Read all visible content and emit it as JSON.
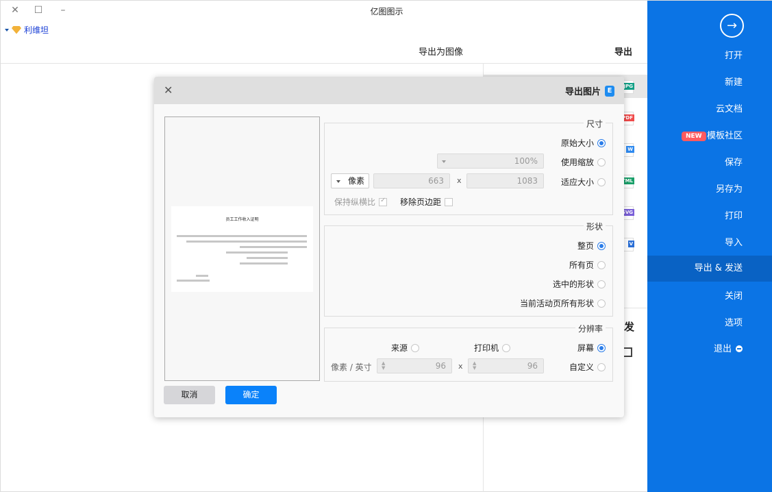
{
  "window": {
    "title": "亿图图示",
    "controls": {
      "close": "✕",
      "maximize": "☐",
      "minimize": "–"
    },
    "user_name": "利维坦"
  },
  "header": {
    "section_title": "导出",
    "subsection_title": "导出为图像"
  },
  "file_types": [
    {
      "label": "JPG",
      "color": "#12a086"
    },
    {
      "label": "PDF",
      "color": "#f04a4a"
    },
    {
      "label": "W",
      "color": "#2f8af0"
    },
    {
      "label": "HTML",
      "color": "#1aa06a"
    },
    {
      "label": "SVG",
      "color": "#7a5fd8"
    },
    {
      "label": "V",
      "color": "#2a6fd6"
    }
  ],
  "send_section": {
    "title": "发"
  },
  "sidebar": {
    "back_icon": "→",
    "items": [
      {
        "label": "打开"
      },
      {
        "label": "新建"
      },
      {
        "label": "云文档"
      },
      {
        "label": "模板社区",
        "badge": "NEW"
      },
      {
        "label": "保存"
      },
      {
        "label": "另存为"
      },
      {
        "label": "打印"
      },
      {
        "label": "导入"
      },
      {
        "label": "导出 & 发送",
        "active": true
      },
      {
        "label": "关闭"
      },
      {
        "label": "选项"
      },
      {
        "label": "退出"
      }
    ],
    "accent_color": "#0b74e5",
    "badge_color": "#ff5a5f"
  },
  "dialog": {
    "title": "导出图片",
    "logo": "E",
    "close_icon": "✕",
    "preview": {
      "doc_title": "员工工作收入证明"
    },
    "size": {
      "legend": "尺寸",
      "options": [
        "原始大小",
        "使用缩放",
        "适应大小"
      ],
      "selected": "原始大小",
      "zoom_value": "100%",
      "width_value": "1083",
      "height_value": "663",
      "x_label": "x",
      "unit": "像素",
      "remove_margin_label": "移除页边距",
      "keep_ratio_label": "保持纵横比"
    },
    "shape": {
      "legend": "形状",
      "options": [
        "整页",
        "所有页",
        "选中的形状",
        "当前活动页所有形状"
      ],
      "selected": "整页"
    },
    "resolution": {
      "legend": "分辨率",
      "options": [
        "屏幕",
        "打印机",
        "来源",
        "自定义"
      ],
      "selected": "屏幕",
      "dpi_x": "96",
      "dpi_y": "96",
      "x_label": "x",
      "unit_label": "像素 / 英寸"
    },
    "buttons": {
      "cancel": "取消",
      "ok": "确定"
    },
    "ok_color": "#0a82fa"
  }
}
